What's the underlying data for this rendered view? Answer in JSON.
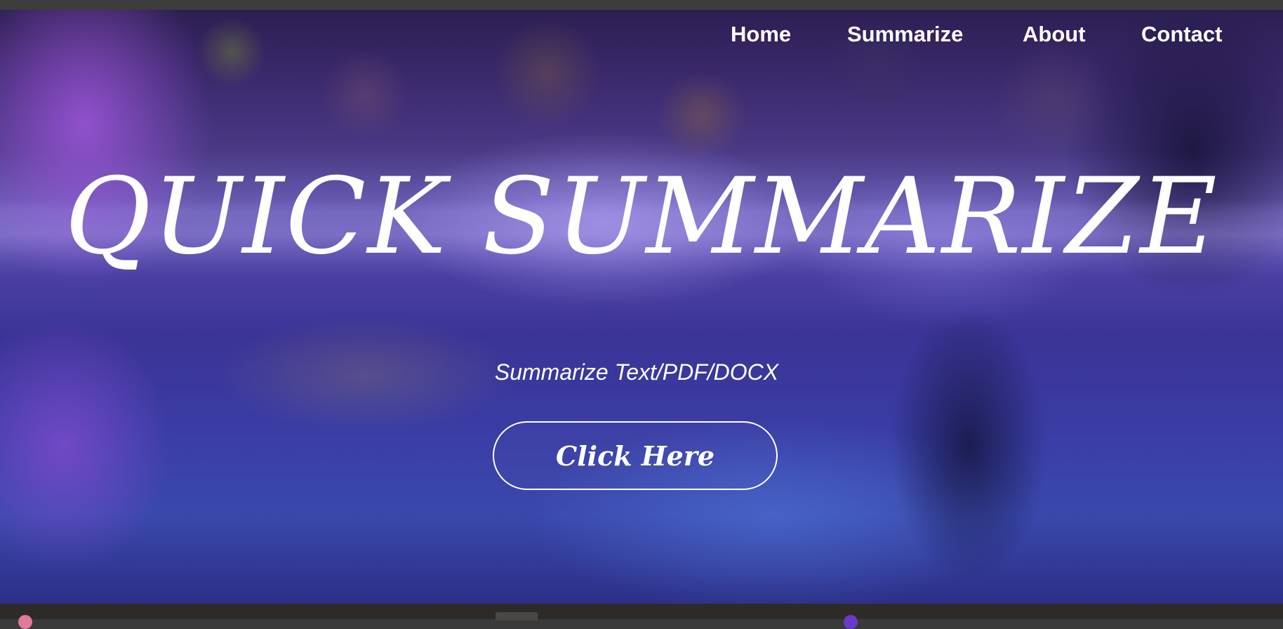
{
  "nav": {
    "home": "Home",
    "summarize": "Summarize",
    "about": "About",
    "contact": "Contact"
  },
  "hero": {
    "title": "QUICK SUMMARIZE",
    "subtitle": "Summarize Text/PDF/DOCX",
    "cta_label": "Click Here"
  },
  "colors": {
    "text": "#ffffff",
    "background_accent": "#3b3496"
  }
}
